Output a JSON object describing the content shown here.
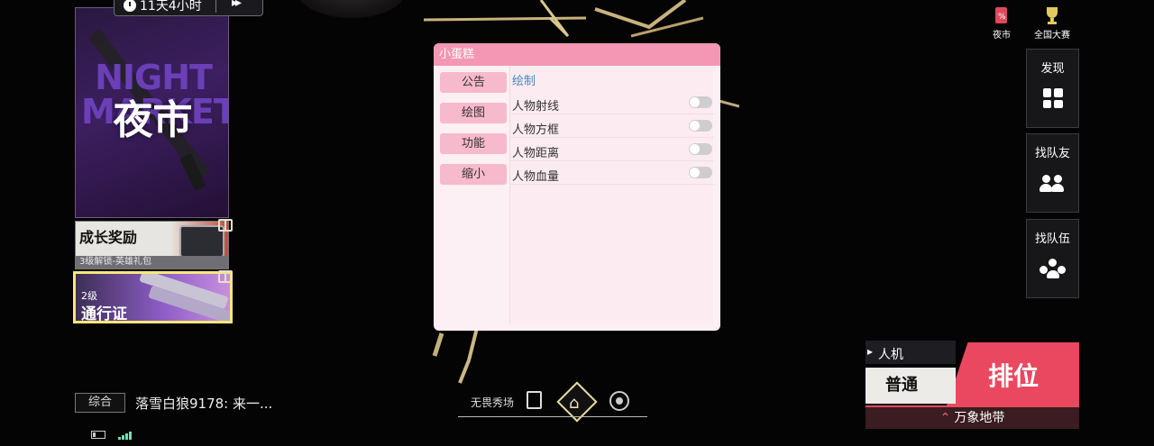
{
  "timer": {
    "text": "11天4小时",
    "arrows": "▸▸"
  },
  "night_market": {
    "bg_text": "NIGHT MARKET",
    "title": "夜市"
  },
  "growth_reward": {
    "title": "成长奖励",
    "subtitle": "3级解锁-英雄礼包"
  },
  "battle_pass": {
    "level": "2级",
    "name": "通行证"
  },
  "chat": {
    "channel": "综合",
    "message": "落雪白狼9178: 来一..."
  },
  "menu": {
    "title": "小蛋糕",
    "tabs": [
      "公告",
      "绘图",
      "功能",
      "缩小"
    ],
    "section": "绘制",
    "options": [
      {
        "label": "人物射线",
        "on": false
      },
      {
        "label": "人物方框",
        "on": false
      },
      {
        "label": "人物距离",
        "on": false
      },
      {
        "label": "人物血量",
        "on": false
      }
    ]
  },
  "top_right": {
    "night_market": "夜市",
    "national": "全国大赛"
  },
  "side": {
    "discover": "发现",
    "find_friends": "找队友",
    "find_team": "找队伍"
  },
  "modes": {
    "bot": "人机",
    "normal": "普通",
    "ranked": "排位",
    "map": "万象地带"
  },
  "bottom_nav": {
    "showcase": "无畏秀场"
  },
  "colors": {
    "accent": "#f497b4",
    "ranked": "#ea4860",
    "pass_border": "#f6e77a"
  }
}
